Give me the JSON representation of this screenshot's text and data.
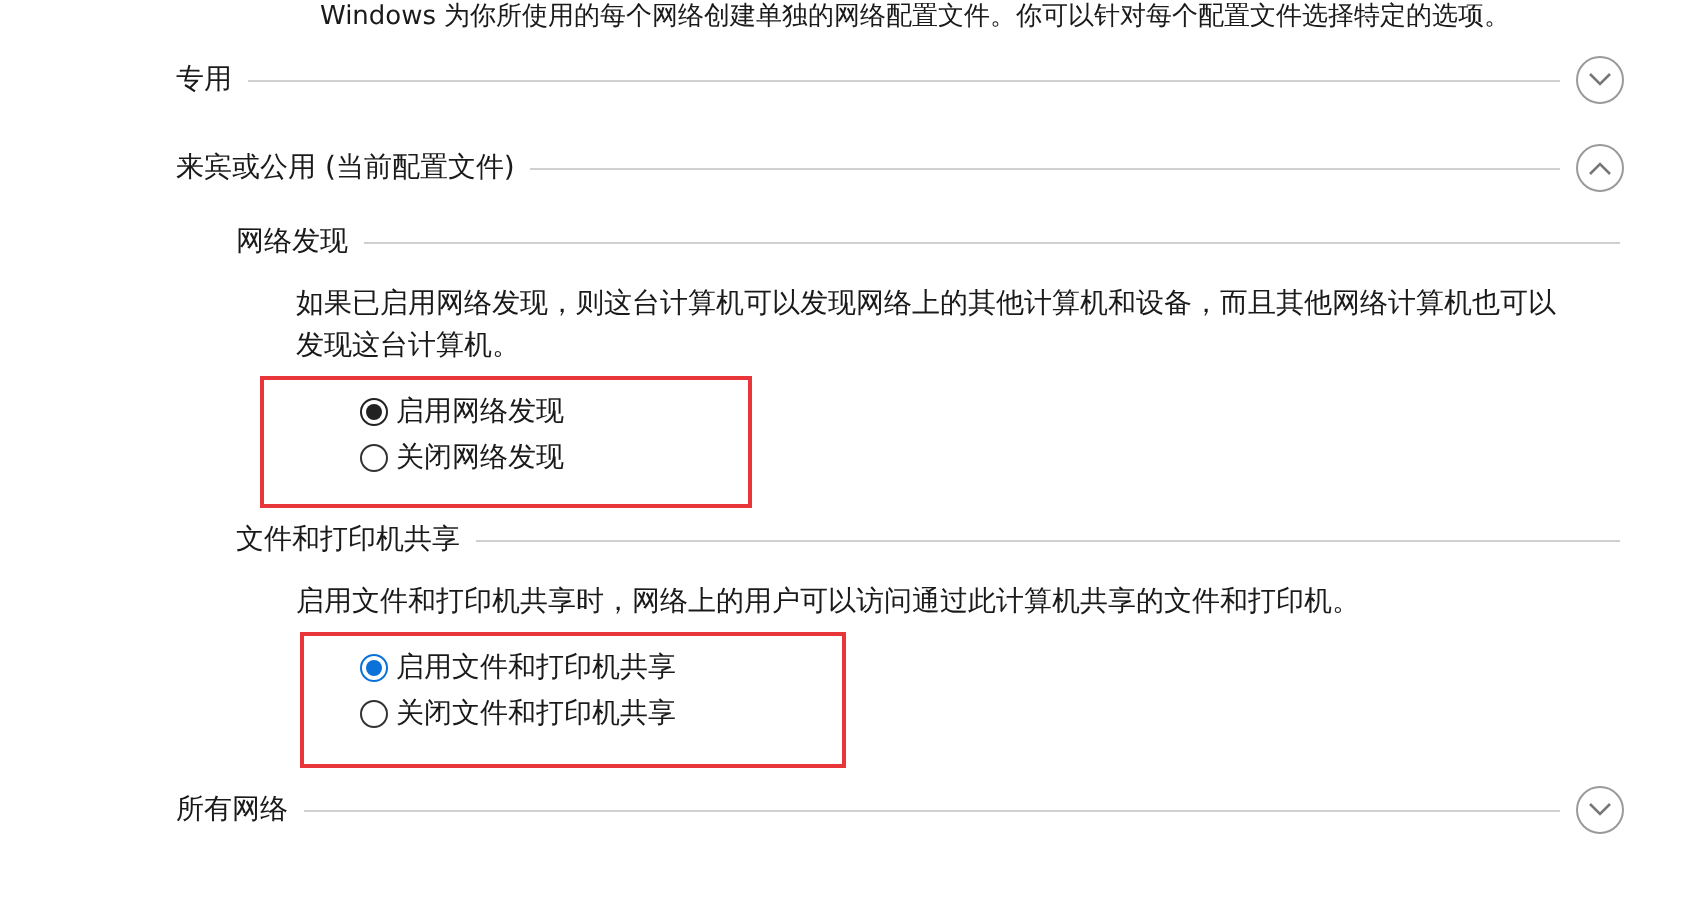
{
  "intro": "Windows 为你所使用的每个网络创建单独的网络配置文件。你可以针对每个配置文件选择特定的选项。",
  "sections": [
    {
      "title": "专用",
      "expanded": false
    },
    {
      "title": "来宾或公用 (当前配置文件)",
      "expanded": true,
      "subsections": [
        {
          "title": "网络发现",
          "description": "如果已启用网络发现，则这台计算机可以发现网络上的其他计算机和设备，而且其他网络计算机也可以发现这台计算机。",
          "highlighted": true,
          "color": "#222222",
          "options": [
            {
              "label": "启用网络发现",
              "selected": true
            },
            {
              "label": "关闭网络发现",
              "selected": false
            }
          ]
        },
        {
          "title": "文件和打印机共享",
          "description": "启用文件和打印机共享时，网络上的用户可以访问通过此计算机共享的文件和打印机。",
          "highlighted": true,
          "color": "#0a72d8",
          "options": [
            {
              "label": "启用文件和打印机共享",
              "selected": true
            },
            {
              "label": "关闭文件和打印机共享",
              "selected": false
            }
          ]
        }
      ]
    },
    {
      "title": "所有网络",
      "expanded": false
    }
  ]
}
